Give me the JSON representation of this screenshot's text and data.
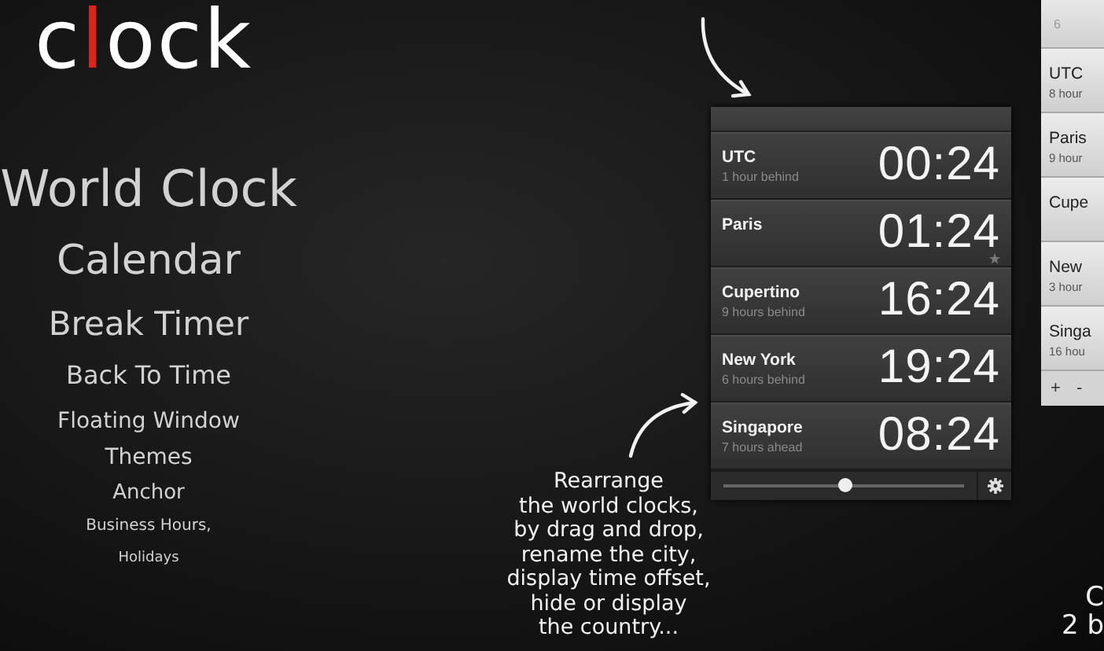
{
  "logo": [
    {
      "text": "c",
      "accent": false
    },
    {
      "text": "l",
      "accent": true
    },
    {
      "text": "ock",
      "accent": false
    }
  ],
  "features": [
    "World Clock",
    "Calendar",
    "Break Timer",
    "Back To Time",
    "Floating Window",
    "Themes",
    "Anchor",
    "Business Hours,",
    "Holidays"
  ],
  "widget": {
    "clocks": [
      {
        "city": "UTC",
        "offset": "1 hour behind",
        "time": "00:24",
        "starred": false
      },
      {
        "city": "Paris",
        "time": "01:24",
        "starred": true
      },
      {
        "city": "Cupertino",
        "offset": "9 hours behind",
        "time": "16:24",
        "starred": false
      },
      {
        "city": "New York",
        "offset": "6 hours behind",
        "time": "19:24",
        "starred": false
      },
      {
        "city": "Singapore",
        "offset": "7 hours ahead",
        "time": "08:24",
        "starred": false
      }
    ],
    "slider": {
      "level": 0.5
    }
  },
  "caption": [
    "Rearrange",
    "the world clocks,",
    "by drag and drop,",
    "rename the city,",
    "display time offset,",
    "hide or display",
    "the country..."
  ],
  "side_window": {
    "header": "6",
    "rows": [
      {
        "city": "UTC",
        "offset": "8 hour"
      },
      {
        "city": "Paris",
        "offset": "9 hour"
      },
      {
        "city": "Cupe"
      },
      {
        "city": "New",
        "offset": "3 hour"
      },
      {
        "city": "Singa",
        "offset": "16 hou"
      }
    ],
    "buttons": [
      "+",
      "-"
    ]
  },
  "corner_text": [
    "C",
    "2 b"
  ]
}
